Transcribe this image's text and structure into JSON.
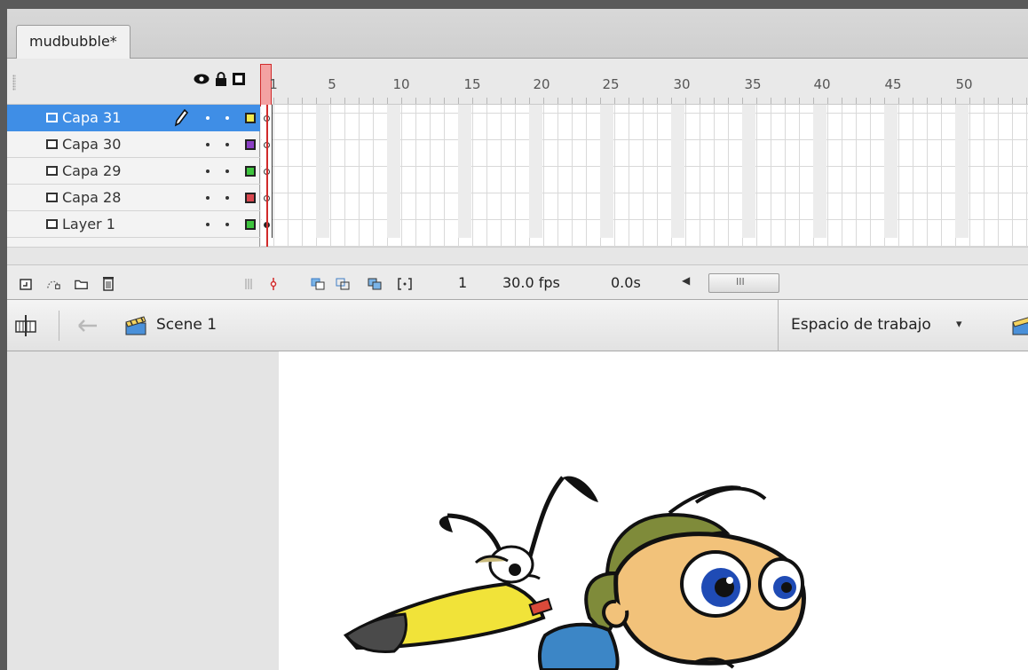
{
  "document_tab": {
    "label": "mudbubble*"
  },
  "timeline": {
    "frame_numbers": [
      "1",
      "5",
      "10",
      "15",
      "20",
      "25",
      "30",
      "35",
      "40",
      "45",
      "50"
    ],
    "layers": [
      {
        "name": "Capa 31",
        "selected": true,
        "color": "#f2ea4d",
        "keyframe": "empty"
      },
      {
        "name": "Capa 30",
        "selected": false,
        "color": "#8b3fc4",
        "keyframe": "empty"
      },
      {
        "name": "Capa 29",
        "selected": false,
        "color": "#3ec43e",
        "keyframe": "empty"
      },
      {
        "name": "Capa 28",
        "selected": false,
        "color": "#d9474f",
        "keyframe": "empty"
      },
      {
        "name": "Layer 1",
        "selected": false,
        "color": "#3ec43e",
        "keyframe": "filled"
      }
    ],
    "status": {
      "current_frame": "1",
      "frame_rate": "30.0 fps",
      "elapsed_time": "0.0s",
      "scroll_grip": "III"
    }
  },
  "edit_bar": {
    "scene_label": "Scene 1",
    "workspace_label": "Espacio de trabajo",
    "workspace_arrow": "▾"
  },
  "icons": {
    "eye": "eye-icon",
    "lock": "lock-icon",
    "outline": "outline-icon",
    "pencil": "pencil-icon",
    "new_layer": "new-layer-icon",
    "motion_guide": "motion-guide-icon",
    "folder": "folder-icon",
    "trash": "trash-icon",
    "onion_skin": "onion-skin-icon",
    "back_arrow": "back-arrow-icon",
    "clapper": "clapper-icon"
  },
  "colors": {
    "selection": "#3f8ee6",
    "playhead": "#d12b2b"
  }
}
